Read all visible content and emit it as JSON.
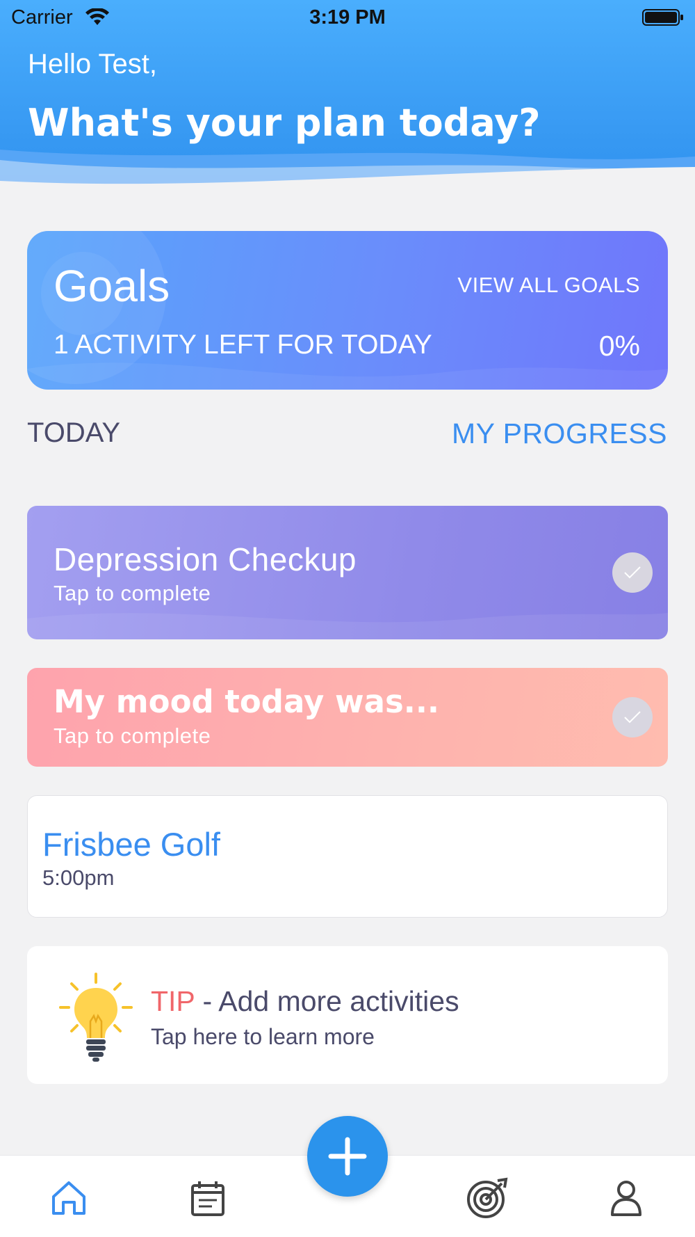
{
  "status_bar": {
    "carrier": "Carrier",
    "time": "3:19 PM",
    "icons": [
      "wifi-icon",
      "battery-icon"
    ]
  },
  "header": {
    "greeting": "Hello Test,",
    "headline": "What's your plan today?"
  },
  "goals_card": {
    "title": "Goals",
    "view_all": "VIEW ALL GOALS",
    "activities_left": "1 ACTIVITY LEFT FOR TODAY",
    "percent": "0%"
  },
  "section": {
    "today": "TODAY",
    "my_progress": "MY PROGRESS"
  },
  "activities": [
    {
      "title": "Depression Checkup",
      "subtitle": "Tap to complete",
      "completed": false
    },
    {
      "title": "My mood today was...",
      "subtitle": "Tap to complete",
      "completed": false
    }
  ],
  "event": {
    "title": "Frisbee Golf",
    "time": "5:00pm"
  },
  "tip": {
    "label": "TIP",
    "text": " - Add more activities",
    "subtitle": "Tap here to learn more",
    "icon": "lightbulb-icon"
  },
  "tabbar": {
    "items": [
      "home-icon",
      "calendar-icon",
      "add-icon",
      "target-icon",
      "profile-icon"
    ],
    "active": "home-icon"
  },
  "colors": {
    "header_blue": "#3a9cf4",
    "accent_blue": "#3a8ef0",
    "tip_red": "#f0666a",
    "purple_card": "#908ae9",
    "pink_card": "#feb3ae"
  }
}
